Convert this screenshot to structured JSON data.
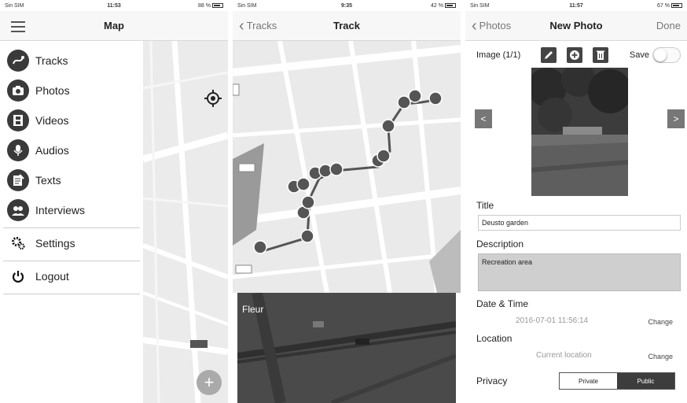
{
  "phone1": {
    "status": {
      "carrier": "Sin SIM",
      "time": "11:53",
      "battery": "88 %"
    },
    "title": "Map",
    "menu": [
      {
        "label": "Tracks",
        "icon": "tracks-icon"
      },
      {
        "label": "Photos",
        "icon": "camera-icon"
      },
      {
        "label": "Videos",
        "icon": "film-icon"
      },
      {
        "label": "Audios",
        "icon": "microphone-icon"
      },
      {
        "label": "Texts",
        "icon": "notepad-icon"
      },
      {
        "label": "Interviews",
        "icon": "interview-icon"
      }
    ],
    "settings_label": "Settings",
    "logout_label": "Logout"
  },
  "phone2": {
    "status": {
      "carrier": "Sin SIM",
      "time": "9:35",
      "battery": "42 %"
    },
    "back_label": "Tracks",
    "title": "Track",
    "mini_map_label": "Fleur"
  },
  "phone3": {
    "status": {
      "carrier": "Sin SIM",
      "time": "11:57",
      "battery": "67 %"
    },
    "back_label": "Photos",
    "title": "New Photo",
    "done_label": "Done",
    "image_label": "Image (1/1)",
    "save_label": "Save",
    "prev_arrow": "<",
    "next_arrow": ">",
    "title_label": "Title",
    "title_value": "Deusto garden",
    "description_label": "Description",
    "description_value": "Recreation area",
    "datetime_label": "Date & Time",
    "datetime_value": "2016-07-01 11:56:14",
    "location_label": "Location",
    "location_value": "Current location",
    "change_label": "Change",
    "privacy_label": "Privacy",
    "privacy_options": [
      "Private",
      "Public"
    ],
    "privacy_selected": "Public"
  }
}
